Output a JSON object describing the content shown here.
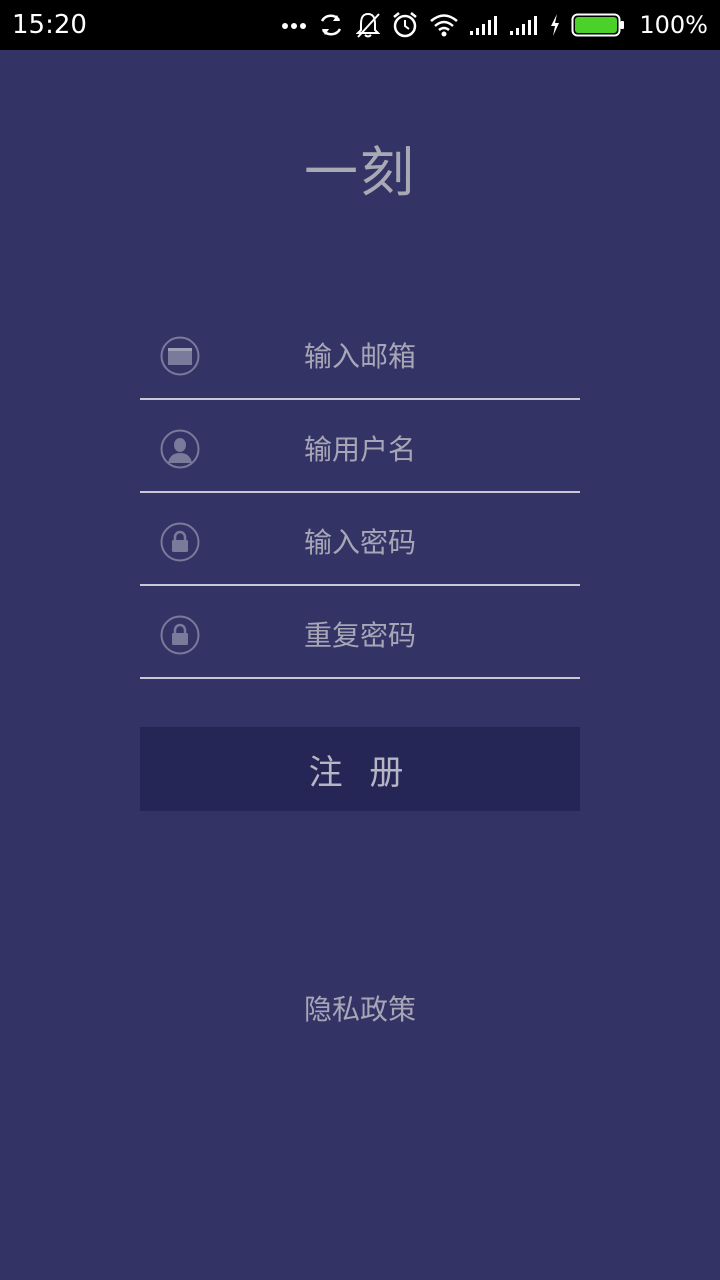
{
  "status_bar": {
    "time": "15:20",
    "battery_percent": "100%",
    "icons": [
      "more-dots-icon",
      "sync-icon",
      "mute-bell-icon",
      "alarm-icon",
      "wifi-icon",
      "signal-icon",
      "signal-icon",
      "charging-icon",
      "battery-icon"
    ]
  },
  "app": {
    "title": "一刻"
  },
  "form": {
    "email_placeholder": "输入邮箱",
    "username_placeholder": "输用户名",
    "password_placeholder": "输入密码",
    "confirm_placeholder": "重复密码",
    "submit_label": "注 册"
  },
  "footer": {
    "privacy_label": "隐私政策"
  },
  "colors": {
    "background": "#343366",
    "button": "#252556",
    "text": "#a7a6b6",
    "battery": "#4bd12a"
  }
}
